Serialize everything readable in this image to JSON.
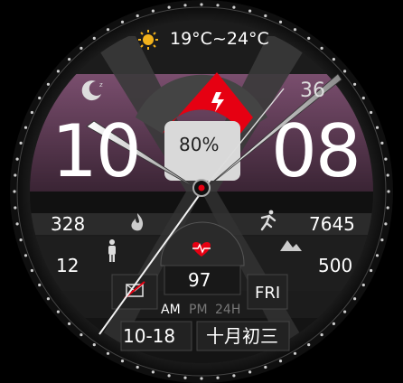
{
  "weather": {
    "temperature_range": "19°C~24°C",
    "icon": "sun-icon"
  },
  "battery": {
    "percent_label": "80%",
    "level": 0.8,
    "icon": "lightning-icon"
  },
  "time": {
    "hour": "10",
    "minute": "08",
    "seconds": "36"
  },
  "stats": {
    "calories": "328",
    "calories_icon": "flame-icon",
    "steps": "7645",
    "steps_icon": "running-person-icon",
    "standing": "12",
    "standing_icon": "standing-person-icon",
    "elevation": "500",
    "elevation_icon": "mountain-icon",
    "heart_rate": "97",
    "heart_icon": "heart-rate-icon"
  },
  "time_format": {
    "am": "AM",
    "pm": "PM",
    "h24": "24H",
    "active": "AM"
  },
  "date": {
    "weekday": "FRI",
    "month_day": "10-18",
    "lunar": "十月初三"
  },
  "notification_icon": "message-muted-icon",
  "sleep_icon": "moon-sleep-icon",
  "colors": {
    "accent": "#e60012",
    "bezel": "#1a1a1a",
    "panel": "#5e3a55",
    "text": "#ffffff"
  }
}
